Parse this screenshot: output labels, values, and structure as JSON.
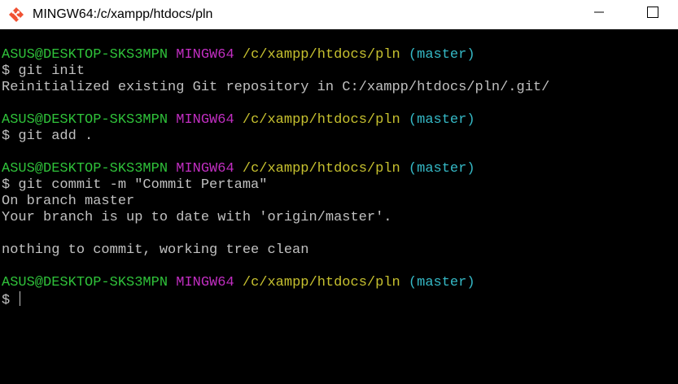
{
  "window": {
    "title": "MINGW64:/c/xampp/htdocs/pln"
  },
  "prompt": {
    "user": "ASUS@DESKTOP-SKS3MPN",
    "system": "MINGW64",
    "path": "/c/xampp/htdocs/pln",
    "branch": "(master)",
    "symbol": "$"
  },
  "session": [
    {
      "command": "git init",
      "output": [
        "Reinitialized existing Git repository in C:/xampp/htdocs/pln/.git/"
      ]
    },
    {
      "command": "git add .",
      "output": []
    },
    {
      "command": "git commit -m \"Commit Pertama\"",
      "output": [
        "On branch master",
        "Your branch is up to date with 'origin/master'.",
        "",
        "nothing to commit, working tree clean"
      ]
    }
  ],
  "colors": {
    "user": "#2fc23a",
    "system": "#c12ec1",
    "path": "#c7c12f",
    "branch": "#35b9c6",
    "text": "#c0c0c0",
    "background": "#000000"
  },
  "icons": {
    "app": "git-diamond-icon",
    "minimize": "minimize-icon",
    "maximize": "maximize-icon"
  }
}
